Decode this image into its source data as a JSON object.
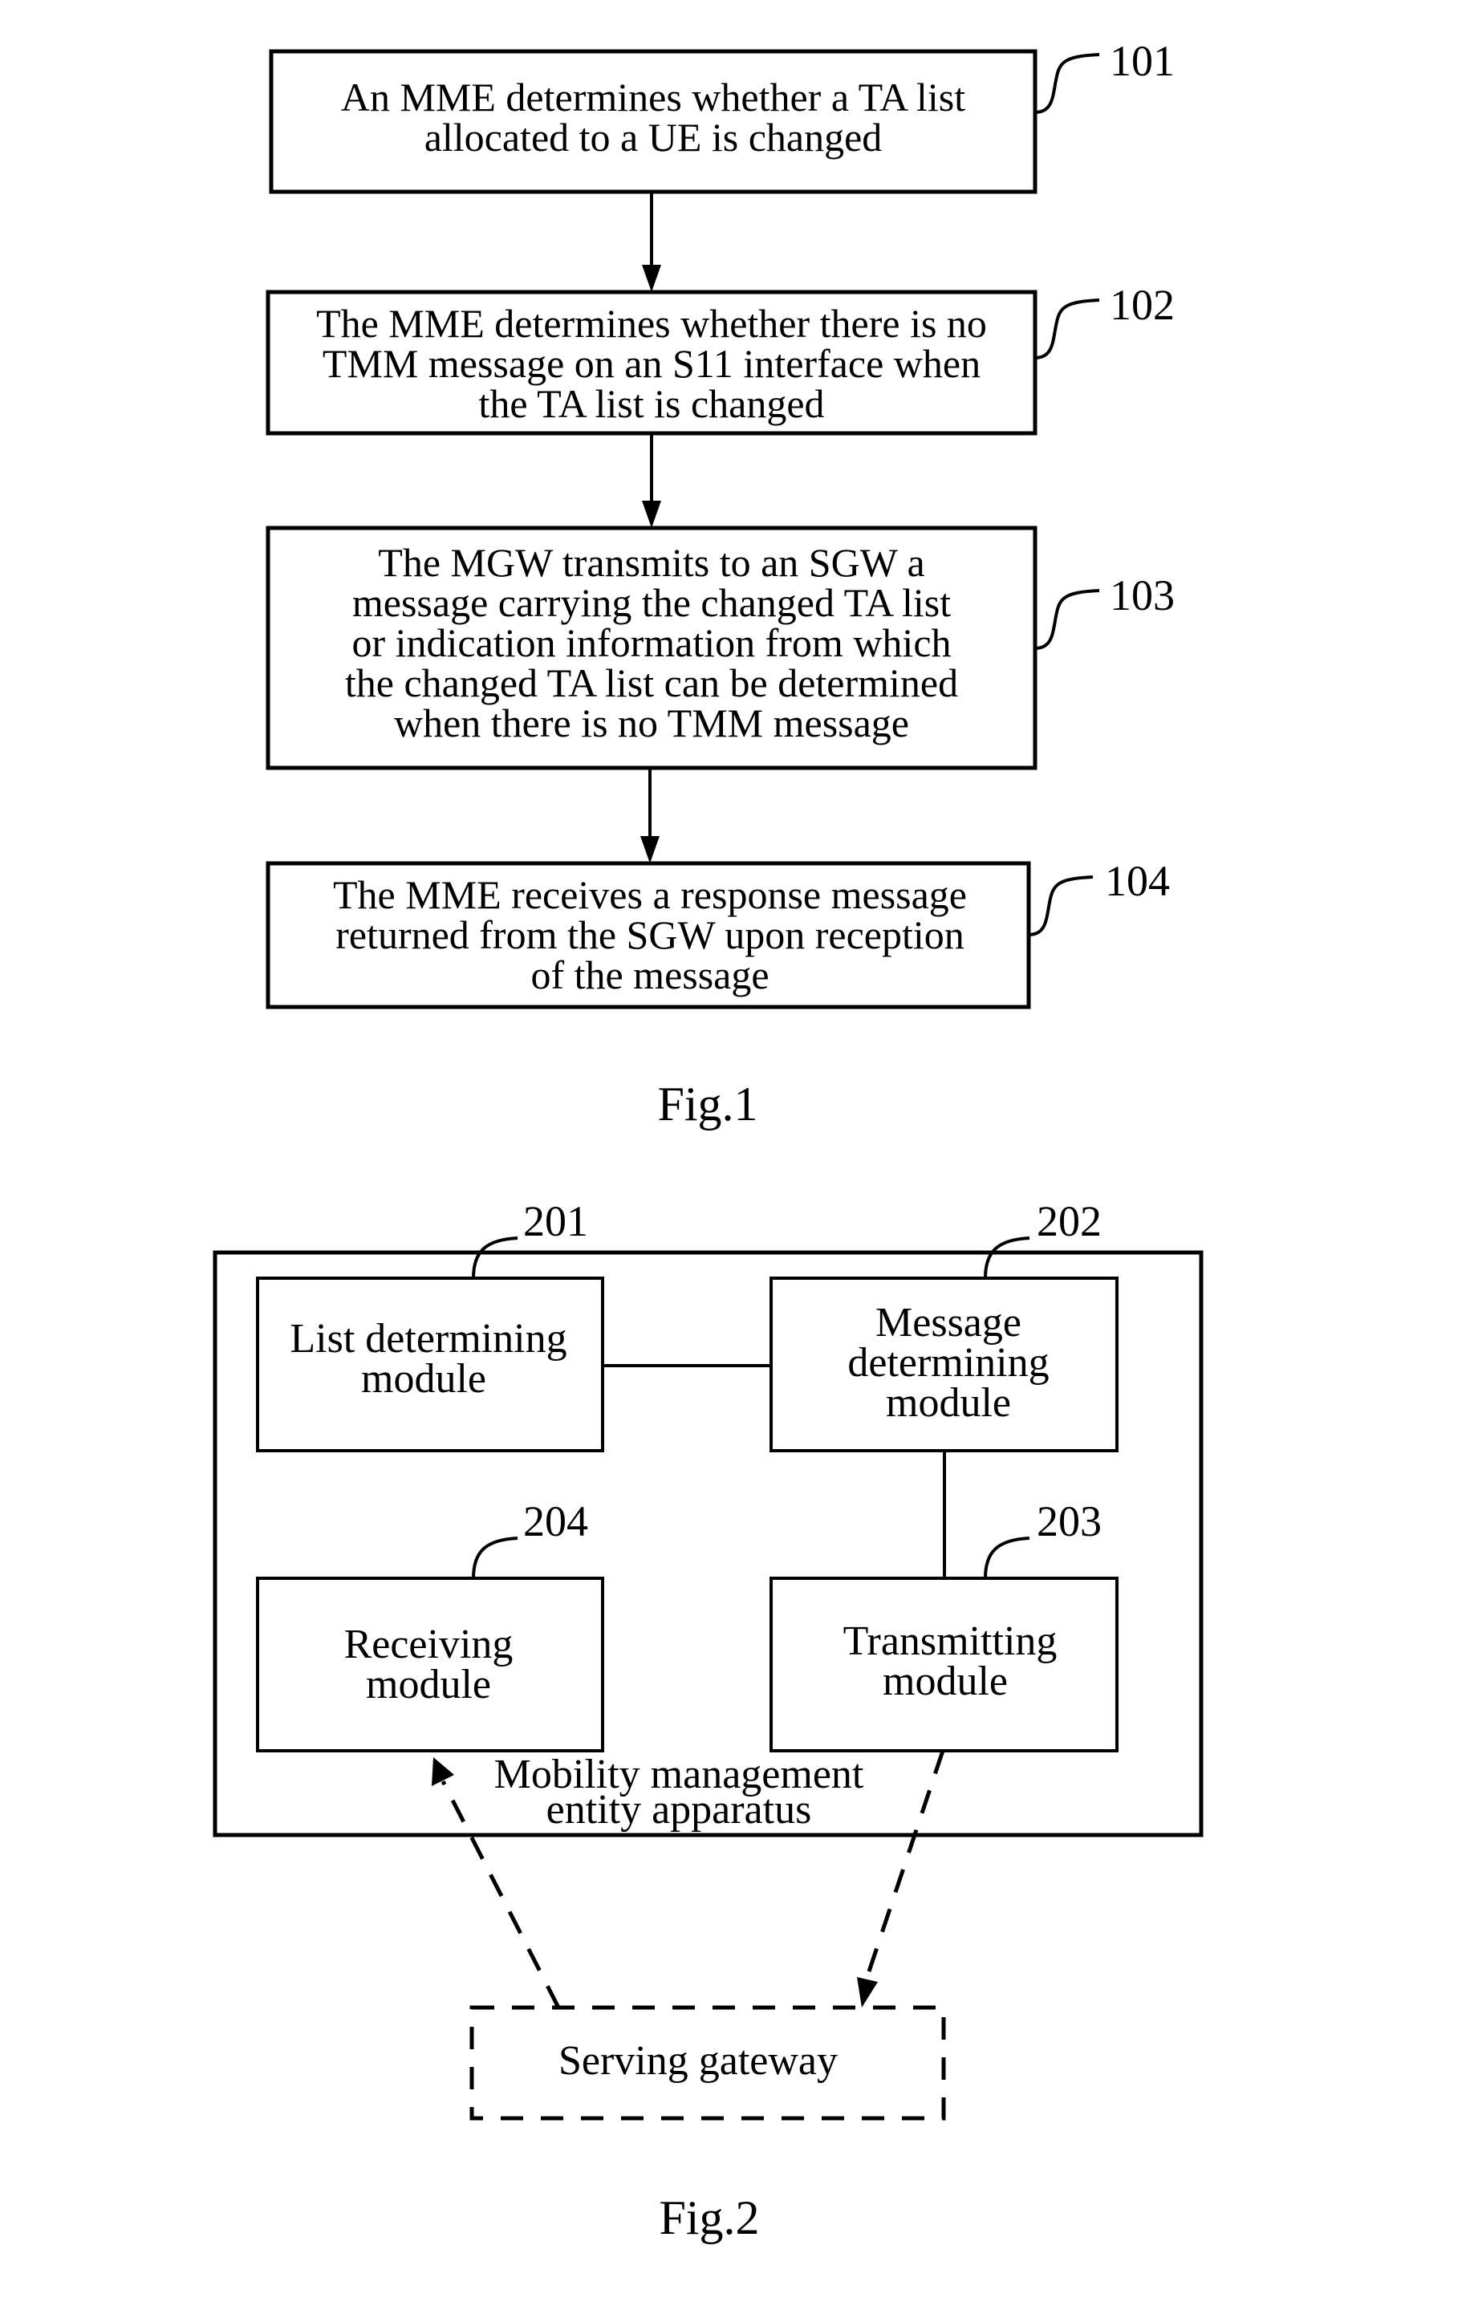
{
  "fig1": {
    "caption": "Fig.1",
    "steps": [
      {
        "ref": "101",
        "lines": [
          "An MME determines whether a TA list",
          "allocated to a UE is changed"
        ]
      },
      {
        "ref": "102",
        "lines": [
          "The MME determines whether there is no",
          "TMM message on an S11 interface when",
          "the TA list is changed"
        ]
      },
      {
        "ref": "103",
        "lines": [
          "The MGW transmits to an SGW a",
          "message carrying the changed TA list",
          "or indication information from which",
          "the changed TA list can be determined",
          "when there is no TMM message"
        ]
      },
      {
        "ref": "104",
        "lines": [
          "The MME receives a response message",
          "returned from the SGW upon reception",
          "of the message"
        ]
      }
    ]
  },
  "fig2": {
    "caption": "Fig.2",
    "container_label": [
      "Mobility management",
      "entity apparatus"
    ],
    "modules": [
      {
        "ref": "201",
        "lines": [
          "List determining",
          "module"
        ]
      },
      {
        "ref": "202",
        "lines": [
          "Message",
          "determining",
          "module"
        ]
      },
      {
        "ref": "203",
        "lines": [
          "Transmitting",
          "module"
        ]
      },
      {
        "ref": "204",
        "lines": [
          "Receiving",
          "module"
        ]
      }
    ],
    "external": {
      "label": "Serving gateway"
    }
  }
}
